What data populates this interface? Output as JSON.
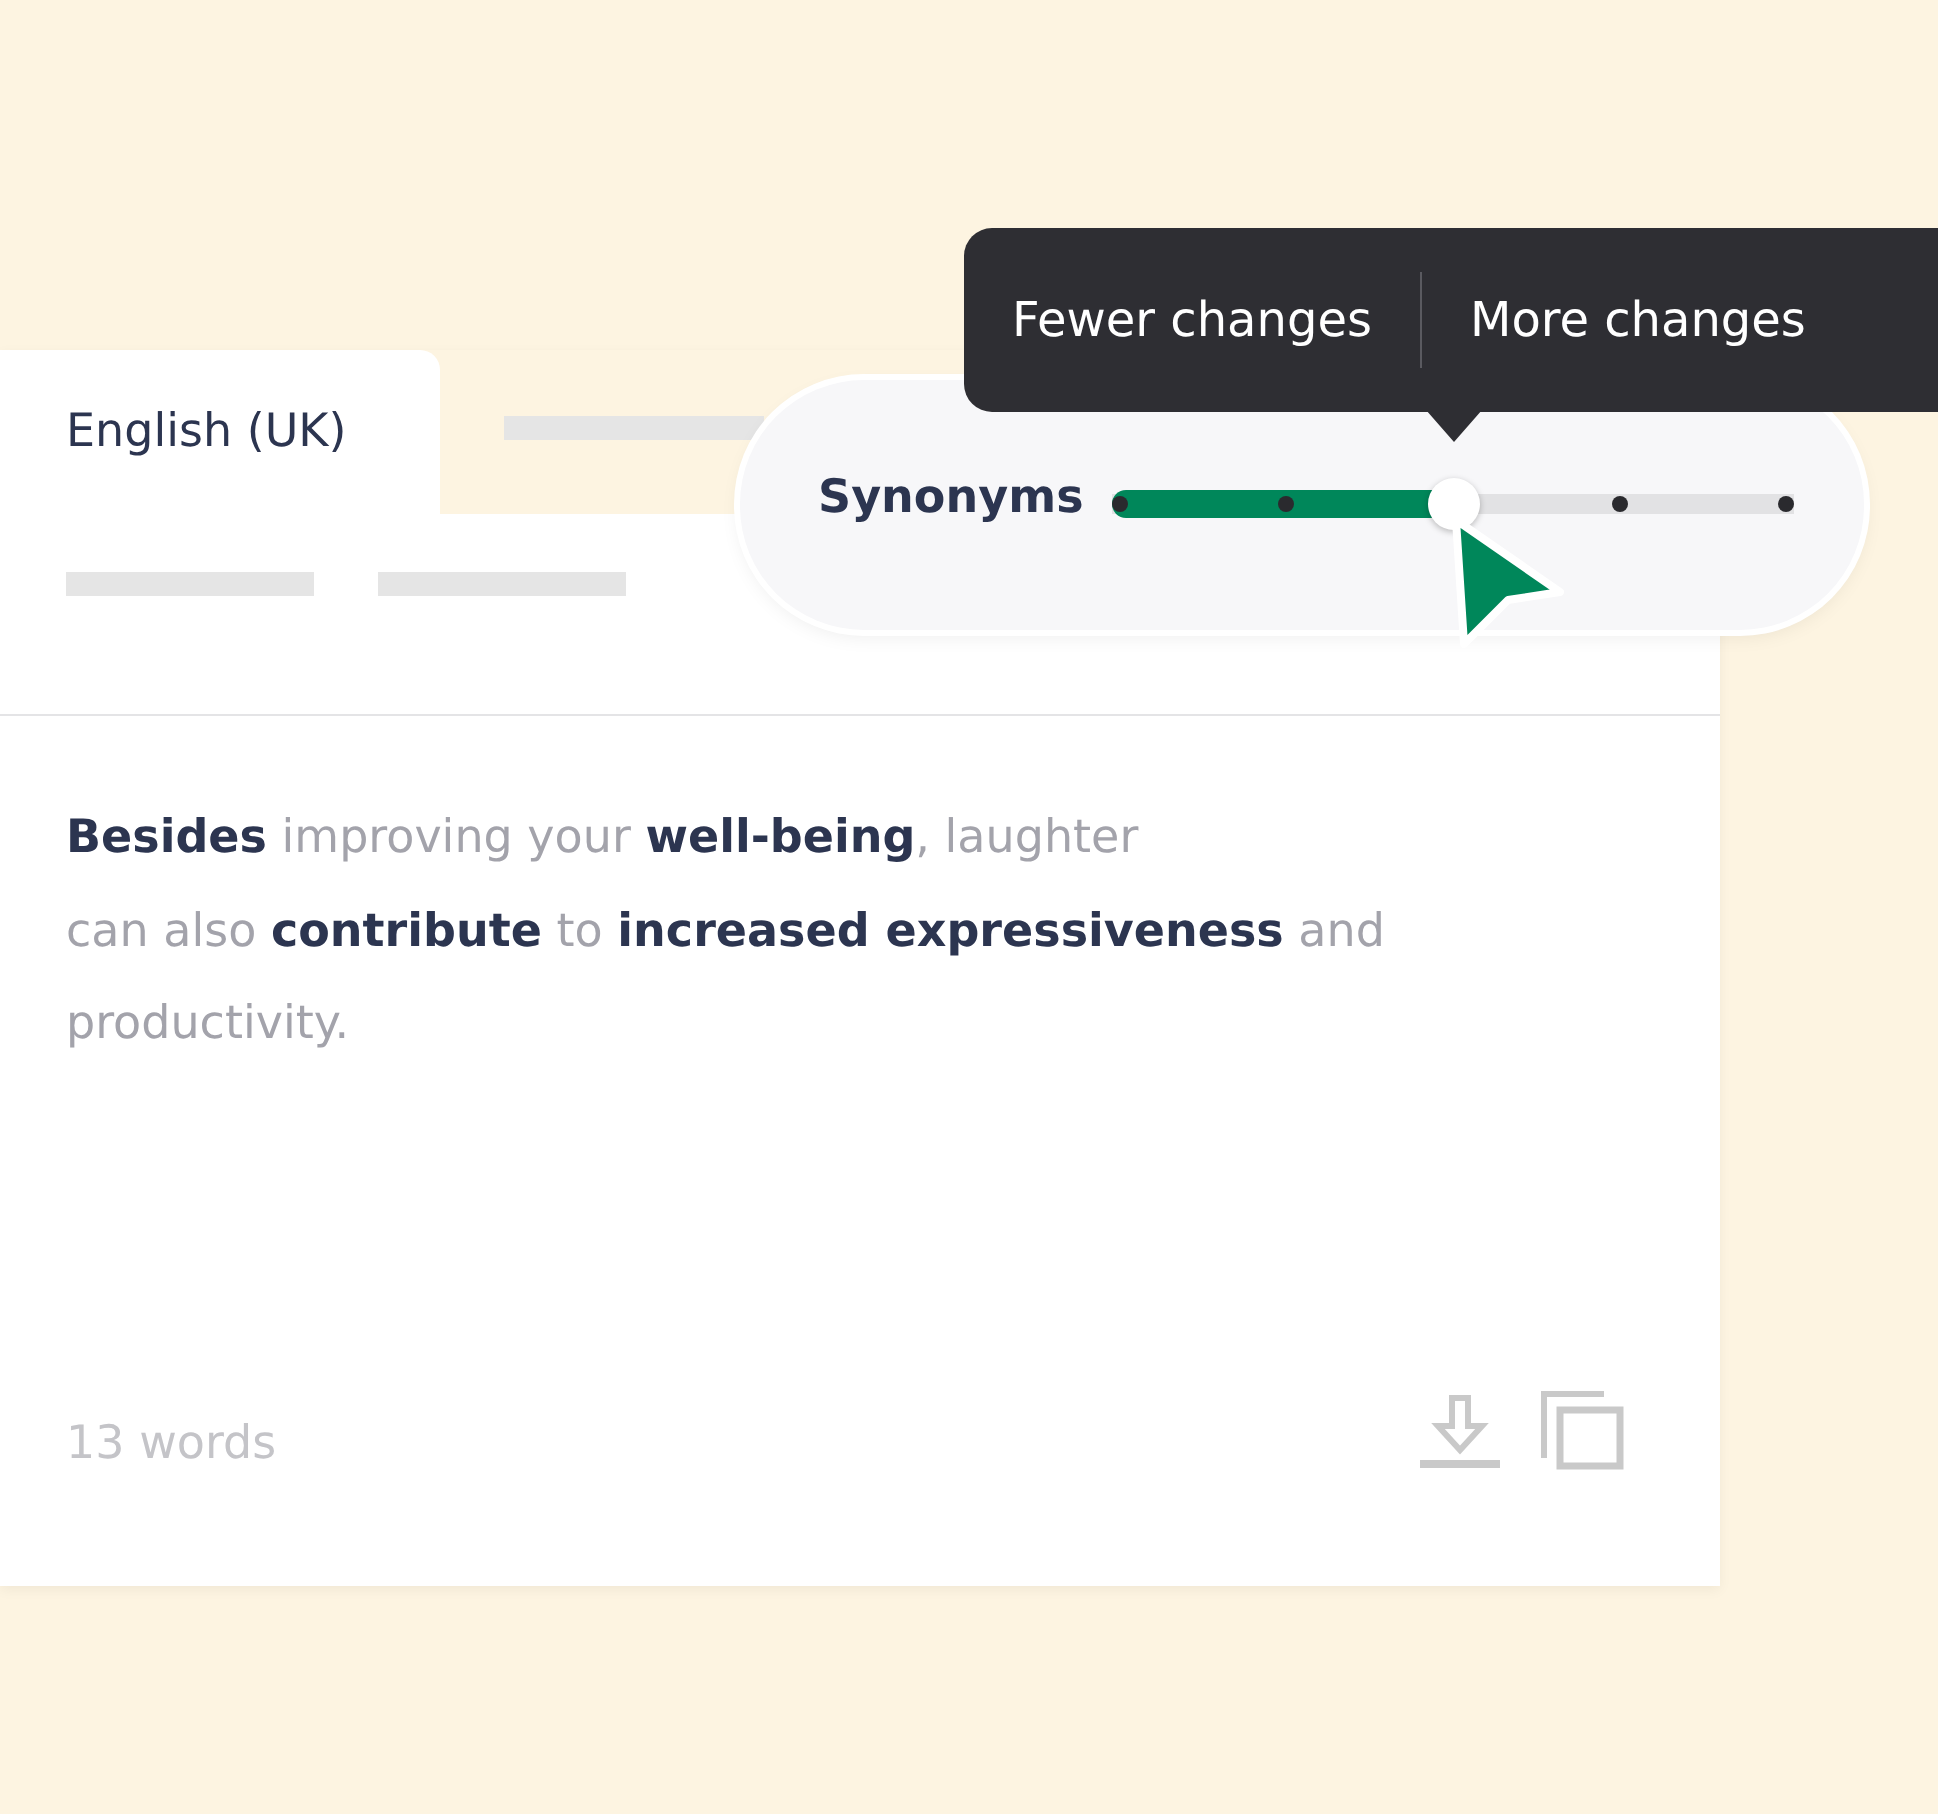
{
  "tab": {
    "label": "English (UK)",
    "selected": true
  },
  "paragraph": [
    "**Besides** improving your **well-being**, laughter",
    "can also **contribute** to **increased expressiveness** and",
    "productivity."
  ],
  "word_count": "13 words",
  "slider": {
    "label": "Synonyms",
    "level": 0.5
  },
  "tooltip": {
    "left": "Fewer changes",
    "right": "More changes"
  }
}
